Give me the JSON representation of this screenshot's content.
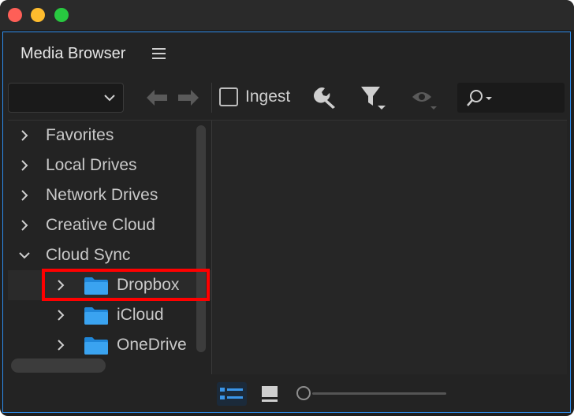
{
  "window": {
    "controls": [
      "close",
      "minimize",
      "maximize"
    ]
  },
  "panel": {
    "title": "Media Browser",
    "menu_icon": "hamburger-icon"
  },
  "toolbar": {
    "dropdown_value": "",
    "ingest_label": "Ingest",
    "ingest_checked": false,
    "icons": [
      "back-arrow-icon",
      "forward-arrow-icon",
      "wrench-icon",
      "filter-icon",
      "eye-icon",
      "search-icon"
    ],
    "search_placeholder": ""
  },
  "tree": {
    "items": [
      {
        "label": "Favorites",
        "expanded": false,
        "level": 0
      },
      {
        "label": "Local Drives",
        "expanded": false,
        "level": 0
      },
      {
        "label": "Network Drives",
        "expanded": false,
        "level": 0
      },
      {
        "label": "Creative Cloud",
        "expanded": false,
        "level": 0
      },
      {
        "label": "Cloud Sync",
        "expanded": true,
        "level": 0
      },
      {
        "label": "Dropbox",
        "expanded": false,
        "level": 1,
        "folder": true,
        "selected": true
      },
      {
        "label": "iCloud",
        "expanded": false,
        "level": 1,
        "folder": true
      },
      {
        "label": "OneDrive",
        "expanded": false,
        "level": 1,
        "folder": true
      }
    ]
  },
  "bottom": {
    "view_modes": [
      "list-view-icon",
      "icon-view-icon"
    ],
    "active_view": "list",
    "zoom_level": 0
  },
  "colors": {
    "accent": "#2d8ceb",
    "folder": "#3aa3f0",
    "highlight": "#ff0000"
  }
}
